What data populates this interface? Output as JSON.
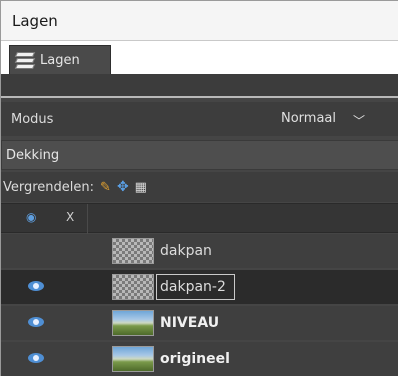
{
  "window": {
    "title": "Lagen"
  },
  "tab": {
    "label": "Lagen",
    "icon": "layers-icon"
  },
  "mode": {
    "label": "Modus",
    "value": "Normaal"
  },
  "opacity": {
    "label": "Dekking"
  },
  "lock": {
    "label": "Vergrendelen:"
  },
  "header": {
    "visibility_icon": "eye-icon",
    "chain_icon": "x-icon"
  },
  "layers": [
    {
      "name": "dakpan",
      "visible": false,
      "thumb": "checker",
      "selected": false,
      "bold": false
    },
    {
      "name": "dakpan-2",
      "visible": true,
      "thumb": "checker",
      "selected": true,
      "bold": false
    },
    {
      "name": "NIVEAU",
      "visible": true,
      "thumb": "photo",
      "selected": false,
      "bold": true
    },
    {
      "name": "origineel",
      "visible": true,
      "thumb": "photo",
      "selected": false,
      "bold": true
    }
  ],
  "colors": {
    "accent": "#4f8fd4",
    "panel": "#454545",
    "selected_row": "#2b2b2b"
  }
}
